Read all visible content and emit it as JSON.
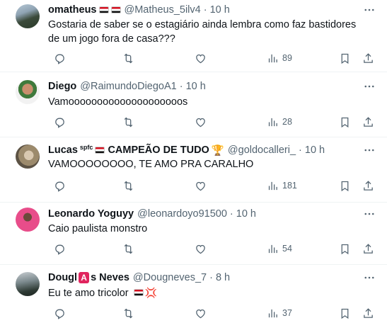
{
  "tweets": [
    {
      "name": "omatheus",
      "flags": [
        "br-flag-icon",
        "br-flag-icon"
      ],
      "handle": "@Matheus_5ilv4",
      "separator": "·",
      "time": "10 h",
      "text": "Gostaria de saber se o estagiário ainda lembra como faz bastidores de um jogo fora de casa???",
      "views": "89"
    },
    {
      "name": "Diego",
      "handle": "@RaimundoDiegoA1",
      "separator": "·",
      "time": "10 h",
      "text": "Vamoooooooooooooooooooos",
      "views": "28"
    },
    {
      "name": "Lucas",
      "badge": "spfc",
      "name_suffix": "CAMPEÃO DE TUDO",
      "handle": "@goldocalleri_",
      "separator": "·",
      "time": "10 h",
      "text": "VAMOOOOOOOO, TE AMO PRA CARALHO",
      "views": "181"
    },
    {
      "name": "Leonardo Yoguyy",
      "handle": "@leonardoyo91500",
      "separator": "·",
      "time": "10 h",
      "text": "Caio paulista monstro",
      "views": "54"
    },
    {
      "name_part1": "Dougl",
      "name_letter": "A",
      "name_part2": "s Neves",
      "handle": "@Dougneves_7",
      "separator": "·",
      "time": "8 h",
      "text": "Eu te amo tricolor",
      "views": "37"
    }
  ],
  "colors": {
    "text": "#0f1419",
    "secondary": "#536471",
    "divider": "#eff3f4"
  },
  "icons": [
    "more-icon",
    "reply-icon",
    "retweet-icon",
    "like-icon",
    "views-icon",
    "bookmark-icon",
    "share-icon"
  ]
}
